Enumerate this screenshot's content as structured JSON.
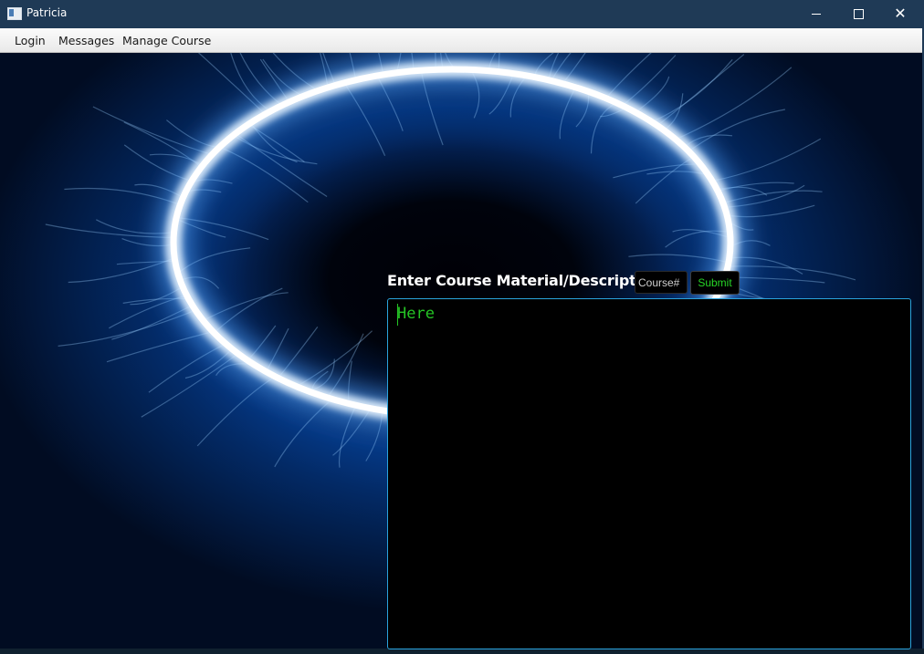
{
  "window": {
    "title": "Patricia",
    "controls": {
      "minimize": "minimize-icon",
      "maximize": "maximize-icon",
      "close": "close-icon",
      "close_glyph": "✕"
    }
  },
  "menu": {
    "items": [
      "Login",
      "Messages",
      "Manage Course"
    ]
  },
  "form": {
    "label": "Enter Course Material/Description",
    "course_placeholder": "Course#",
    "course_value": "",
    "submit_label": "Submit",
    "textarea_value": "Here"
  },
  "colors": {
    "title_bar": "#1f3a56",
    "text_accent": "#25c525",
    "textarea_border": "#2aa3dd",
    "background_glow": "#0a56c0"
  }
}
